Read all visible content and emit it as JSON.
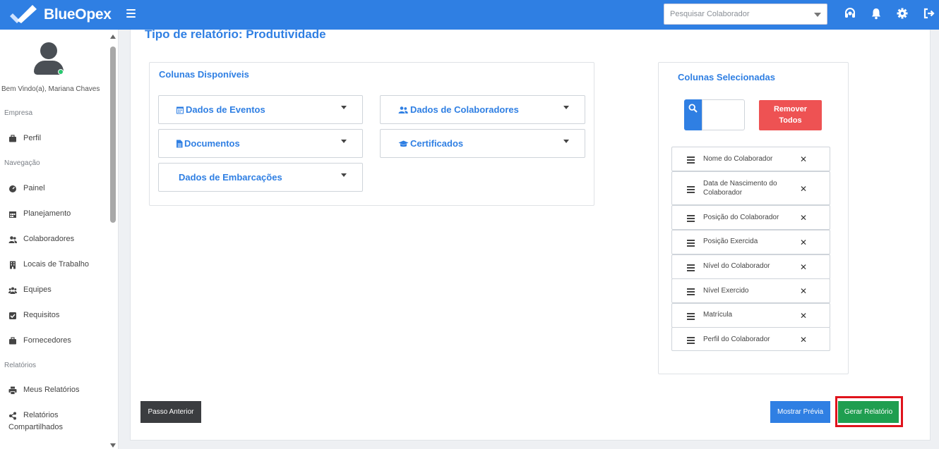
{
  "app": {
    "name": "BlueOpex"
  },
  "topbar": {
    "search_placeholder": "Pesquisar Colaborador",
    "icons": [
      "headset-icon",
      "bell-icon",
      "gear-icon",
      "logout-icon"
    ]
  },
  "sidebar": {
    "welcome": "Bem Vindo(a), Mariana Chaves",
    "sections": {
      "empresa": "Empresa",
      "navegacao": "Navegação",
      "relatorios": "Relatórios"
    },
    "items": {
      "perfil": "Perfil",
      "painel": "Painel",
      "planejamento": "Planejamento",
      "colaboradores": "Colaboradores",
      "locais": "Locais de Trabalho",
      "equipes": "Equipes",
      "requisitos": "Requisitos",
      "fornecedores": "Fornecedores",
      "meus_relatorios": "Meus Relatórios",
      "relatorios_compartilhados_1": "Relatórios",
      "relatorios_compartilhados_2": "Compartilhados"
    }
  },
  "main": {
    "title": "Tipo de relatório: Produtividade",
    "available": {
      "title": "Colunas Disponíveis",
      "groups": {
        "eventos": "Dados de Eventos",
        "colaboradores": "Dados de Colaboradores",
        "documentos": "Documentos",
        "certificados": "Certificados",
        "embarcacoes": "Dados de Embarcações"
      }
    },
    "selected": {
      "title": "Colunas Selecionadas",
      "remove_all_1": "Remover",
      "remove_all_2": "Todos",
      "remove_glyph": "✕",
      "items": [
        "Nome do Colaborador",
        "Data de Nascimento do Colaborador",
        "Posição do Colaborador",
        "Posição Exercida",
        "Nível do Colaborador",
        "Nível Exercido",
        "Matrícula",
        "Perfil do Colaborador"
      ]
    },
    "buttons": {
      "previous": "Passo Anterior",
      "preview": "Mostrar Prévia",
      "generate": "Gerar Relatório"
    }
  },
  "colors": {
    "brand": "#2f7fe3",
    "danger": "#ee5253",
    "success": "#1f9e50",
    "dark": "#3b3d40",
    "highlight": "#e0131c"
  }
}
